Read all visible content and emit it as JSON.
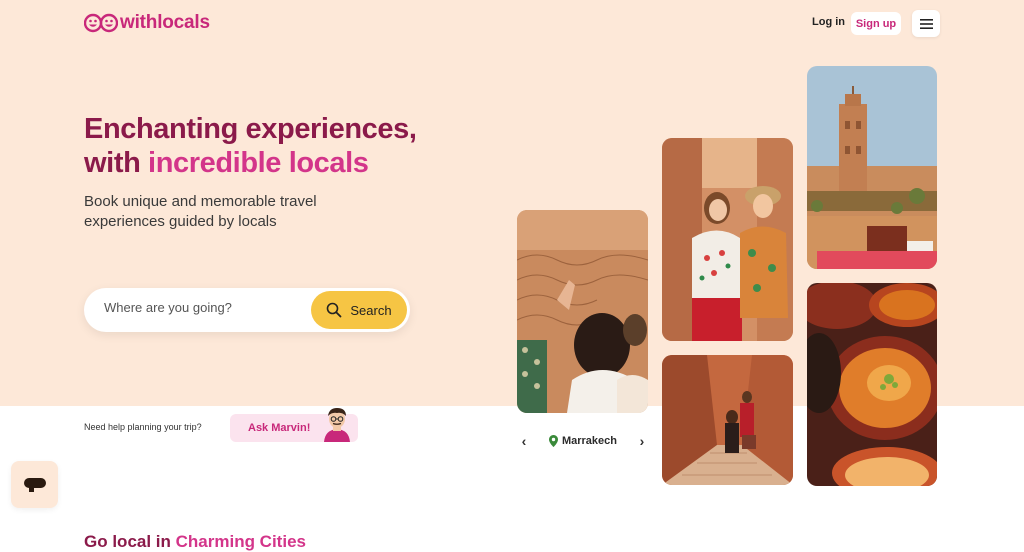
{
  "header": {
    "logo_text": "withlocals",
    "login_label": "Log in",
    "signup_label": "Sign up",
    "menu_icon": "hamburger-icon"
  },
  "hero": {
    "headline_line1": "Enchanting experiences,",
    "headline_line2_prefix": "with ",
    "headline_line2_accent": "incredible locals",
    "subtitle": "Book unique and memorable travel experiences guided by locals"
  },
  "search": {
    "placeholder": "Where are you going?",
    "button_label": "Search",
    "icon": "search-icon"
  },
  "help": {
    "text": "Need help planning your trip?",
    "button_label": "Ask Marvin!"
  },
  "city_nav": {
    "city": "Marrakech",
    "prev_icon": "chevron-left-icon",
    "next_icon": "chevron-right-icon",
    "pin_icon": "map-pin-icon"
  },
  "section": {
    "title_prefix": "Go local in ",
    "title_accent": "Charming Cities"
  },
  "colors": {
    "brand_pink": "#c8287a",
    "headline_plum": "#8b1a4a",
    "accent_pink": "#d3358a",
    "hero_bg": "#fde8d8",
    "search_yellow": "#f6c544"
  }
}
